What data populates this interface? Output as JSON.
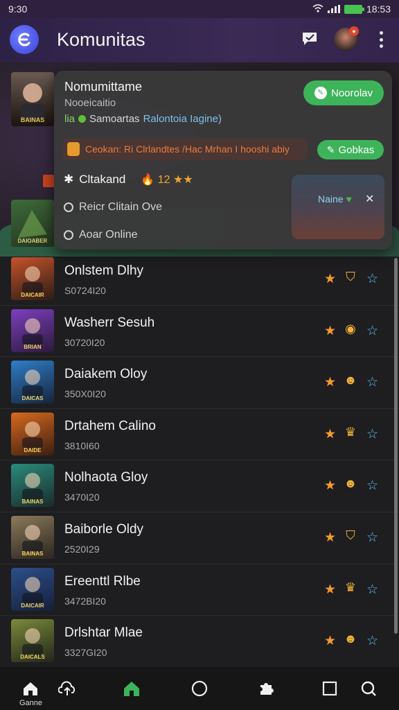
{
  "status": {
    "time": "9:30",
    "right_time": "18:53",
    "battery_color": "#49c24f"
  },
  "app": {
    "title": "Komunitas",
    "logo_icon": "app-logo-icon",
    "accent": "#3a44d8"
  },
  "featured": {
    "thumb_label": "BAINAS",
    "side_thumb_label": "DAIOABER"
  },
  "popup": {
    "name": "Nomumittame",
    "subtitle": "Nooeicaitio",
    "level": "lia",
    "meta_text": "Samoartas",
    "meta_link": "Ralontoia Iagine)",
    "follow_label": "Noorolav",
    "banner_text": "Ceokan: Ri Clrlandtes /Hac Mrhan I hooshi abiy",
    "banner_button": "Gobkas",
    "rank_label": "Cltakand",
    "rank_score": "12",
    "option1": "Reicr Clitain Ove",
    "option2": "Aoar Online",
    "mini_card_label": "Naine",
    "green": "#3db35a",
    "orange": "#ec7a3d"
  },
  "games": [
    {
      "name": "Onlstem Dlhy",
      "number": "S0724I20",
      "thumb_label": "DAICAIR",
      "bg": "linear-gradient(160deg,#c7532a,#2a1c14)",
      "mid_icon": "shield-icon"
    },
    {
      "name": "Washerr Sesuh",
      "number": "30720I20",
      "thumb_label": "BRIAN",
      "bg": "linear-gradient(160deg,#7e3fc0,#2a1a3a)",
      "mid_icon": "target-icon"
    },
    {
      "name": "Daiakem Oloy",
      "number": "350X0I20",
      "thumb_label": "DAICAS",
      "bg": "linear-gradient(160deg,#2f7ec9,#16243a)",
      "mid_icon": "emoji-icon"
    },
    {
      "name": "Drtahem Calino",
      "number": "3810I60",
      "thumb_label": "DAIDE",
      "bg": "linear-gradient(160deg,#d86a1f,#3b1e10)",
      "mid_icon": "crown-icon"
    },
    {
      "name": "Nolhaota Gloy",
      "number": "3470I20",
      "thumb_label": "BAINAS",
      "bg": "linear-gradient(160deg,#2a8c7d,#1a2b2a)",
      "mid_icon": "emoji-icon"
    },
    {
      "name": "Baiborle Oldy",
      "number": "2520I29",
      "thumb_label": "BAINAS",
      "bg": "linear-gradient(160deg,#8c7a5a,#2a2520)",
      "mid_icon": "shield-icon"
    },
    {
      "name": "Ereenttl Rlbe",
      "number": "3472BI20",
      "thumb_label": "DAICAIR",
      "bg": "linear-gradient(160deg,#2c4f8a,#15203a)",
      "mid_icon": "crown-icon"
    },
    {
      "name": "Drlshtar Mlae",
      "number": "3327GI20",
      "thumb_label": "DAICALS",
      "bg": "linear-gradient(160deg,#7a8a3a,#22261a)",
      "mid_icon": "emoji-icon"
    }
  ],
  "nav": {
    "first_label": "Ganne",
    "icons": [
      "home-icon",
      "cloud-upload-icon",
      "home-active-icon",
      "circle-icon",
      "puzzle-icon",
      "square-icon",
      "search-icon"
    ],
    "active_color": "#3db35a"
  }
}
